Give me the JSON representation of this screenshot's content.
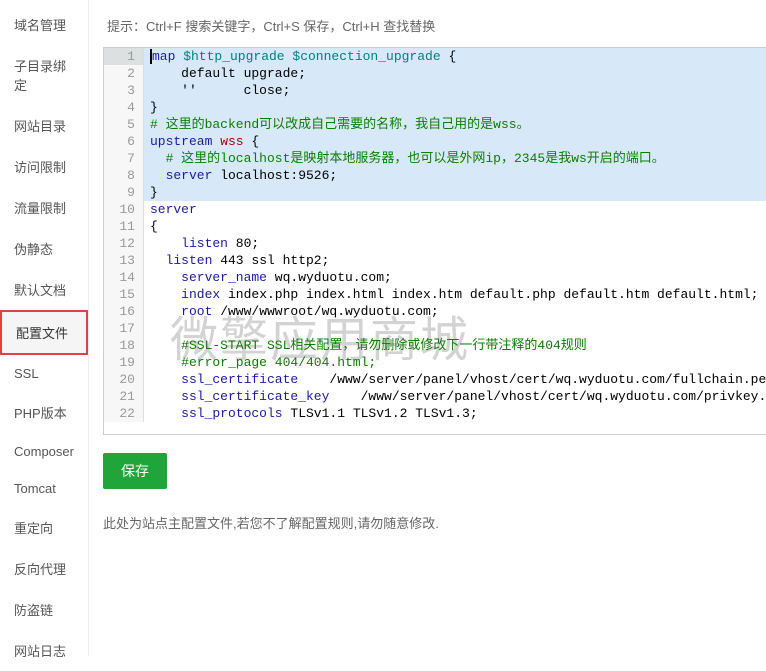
{
  "sidebar": {
    "items": [
      {
        "label": "域名管理"
      },
      {
        "label": "子目录绑定"
      },
      {
        "label": "网站目录"
      },
      {
        "label": "访问限制"
      },
      {
        "label": "流量限制"
      },
      {
        "label": "伪静态"
      },
      {
        "label": "默认文档"
      },
      {
        "label": "配置文件"
      },
      {
        "label": "SSL"
      },
      {
        "label": "PHP版本"
      },
      {
        "label": "Composer"
      },
      {
        "label": "Tomcat"
      },
      {
        "label": "重定向"
      },
      {
        "label": "反向代理"
      },
      {
        "label": "防盗链"
      },
      {
        "label": "网站日志"
      }
    ],
    "active_index": 7
  },
  "hint": "提示：Ctrl+F 搜索关键字，Ctrl+S 保存，Ctrl+H 查找替换",
  "code_lines": [
    {
      "n": 1,
      "sel": true,
      "parts": [
        {
          "t": "map ",
          "c": "kw"
        },
        {
          "t": "$http_upgrade $connection_upgrade ",
          "c": "var"
        },
        {
          "t": "{",
          "c": ""
        }
      ]
    },
    {
      "n": 2,
      "sel": true,
      "parts": [
        {
          "t": "    default upgrade;",
          "c": ""
        }
      ]
    },
    {
      "n": 3,
      "sel": true,
      "parts": [
        {
          "t": "    ''      close;",
          "c": ""
        }
      ]
    },
    {
      "n": 4,
      "sel": true,
      "parts": [
        {
          "t": "}",
          "c": ""
        }
      ]
    },
    {
      "n": 5,
      "sel": true,
      "parts": [
        {
          "t": "# 这里的backend可以改成自己需要的名称，我自己用的是wss。",
          "c": "comment"
        }
      ]
    },
    {
      "n": 6,
      "sel": true,
      "parts": [
        {
          "t": "upstream ",
          "c": "kw"
        },
        {
          "t": "wss ",
          "c": "ident"
        },
        {
          "t": "{",
          "c": ""
        }
      ]
    },
    {
      "n": 7,
      "sel": true,
      "parts": [
        {
          "t": "  # 这里的localhost是映射本地服务器，也可以是外网ip，2345是我ws开启的端口。",
          "c": "comment"
        }
      ]
    },
    {
      "n": 8,
      "sel": true,
      "parts": [
        {
          "t": "  server ",
          "c": "kw"
        },
        {
          "t": "localhost:9526;",
          "c": ""
        }
      ]
    },
    {
      "n": 9,
      "sel": true,
      "parts": [
        {
          "t": "}",
          "c": ""
        }
      ]
    },
    {
      "n": 10,
      "parts": [
        {
          "t": "server",
          "c": "kw"
        }
      ]
    },
    {
      "n": 11,
      "parts": [
        {
          "t": "{",
          "c": ""
        }
      ]
    },
    {
      "n": 12,
      "parts": [
        {
          "t": "    listen ",
          "c": "kw"
        },
        {
          "t": "80;",
          "c": ""
        }
      ]
    },
    {
      "n": 13,
      "parts": [
        {
          "t": "  listen ",
          "c": "kw"
        },
        {
          "t": "443 ssl http2;",
          "c": ""
        }
      ]
    },
    {
      "n": 14,
      "parts": [
        {
          "t": "    server_name ",
          "c": "kw"
        },
        {
          "t": "wq.wyduotu.com;",
          "c": ""
        }
      ]
    },
    {
      "n": 15,
      "parts": [
        {
          "t": "    index ",
          "c": "kw"
        },
        {
          "t": "index.php index.html index.htm default.php default.htm default.html;",
          "c": ""
        }
      ]
    },
    {
      "n": 16,
      "parts": [
        {
          "t": "    root ",
          "c": "kw"
        },
        {
          "t": "/www/wwwroot/wq.wyduotu.com;",
          "c": ""
        }
      ]
    },
    {
      "n": 17,
      "parts": [
        {
          "t": "    ",
          "c": ""
        }
      ]
    },
    {
      "n": 18,
      "parts": [
        {
          "t": "    #SSL-START SSL相关配置，请勿删除或修改下一行带注释的404规则",
          "c": "comment"
        }
      ]
    },
    {
      "n": 19,
      "parts": [
        {
          "t": "    #error_page 404/404.html;",
          "c": "comment"
        }
      ]
    },
    {
      "n": 20,
      "parts": [
        {
          "t": "    ssl_certificate    ",
          "c": "kw"
        },
        {
          "t": "/www/server/panel/vhost/cert/wq.wyduotu.com/fullchain.pem;",
          "c": ""
        }
      ]
    },
    {
      "n": 21,
      "parts": [
        {
          "t": "    ssl_certificate_key    ",
          "c": "kw"
        },
        {
          "t": "/www/server/panel/vhost/cert/wq.wyduotu.com/privkey.pem;",
          "c": ""
        }
      ]
    },
    {
      "n": 22,
      "parts": [
        {
          "t": "    ssl_protocols ",
          "c": "kw"
        },
        {
          "t": "TLSv1.1 TLSv1.2 TLSv1.3;",
          "c": ""
        }
      ]
    }
  ],
  "save_button": "保存",
  "footer_hint": "此处为站点主配置文件,若您不了解配置规则,请勿随意修改.",
  "watermark": "微擎应用商城"
}
